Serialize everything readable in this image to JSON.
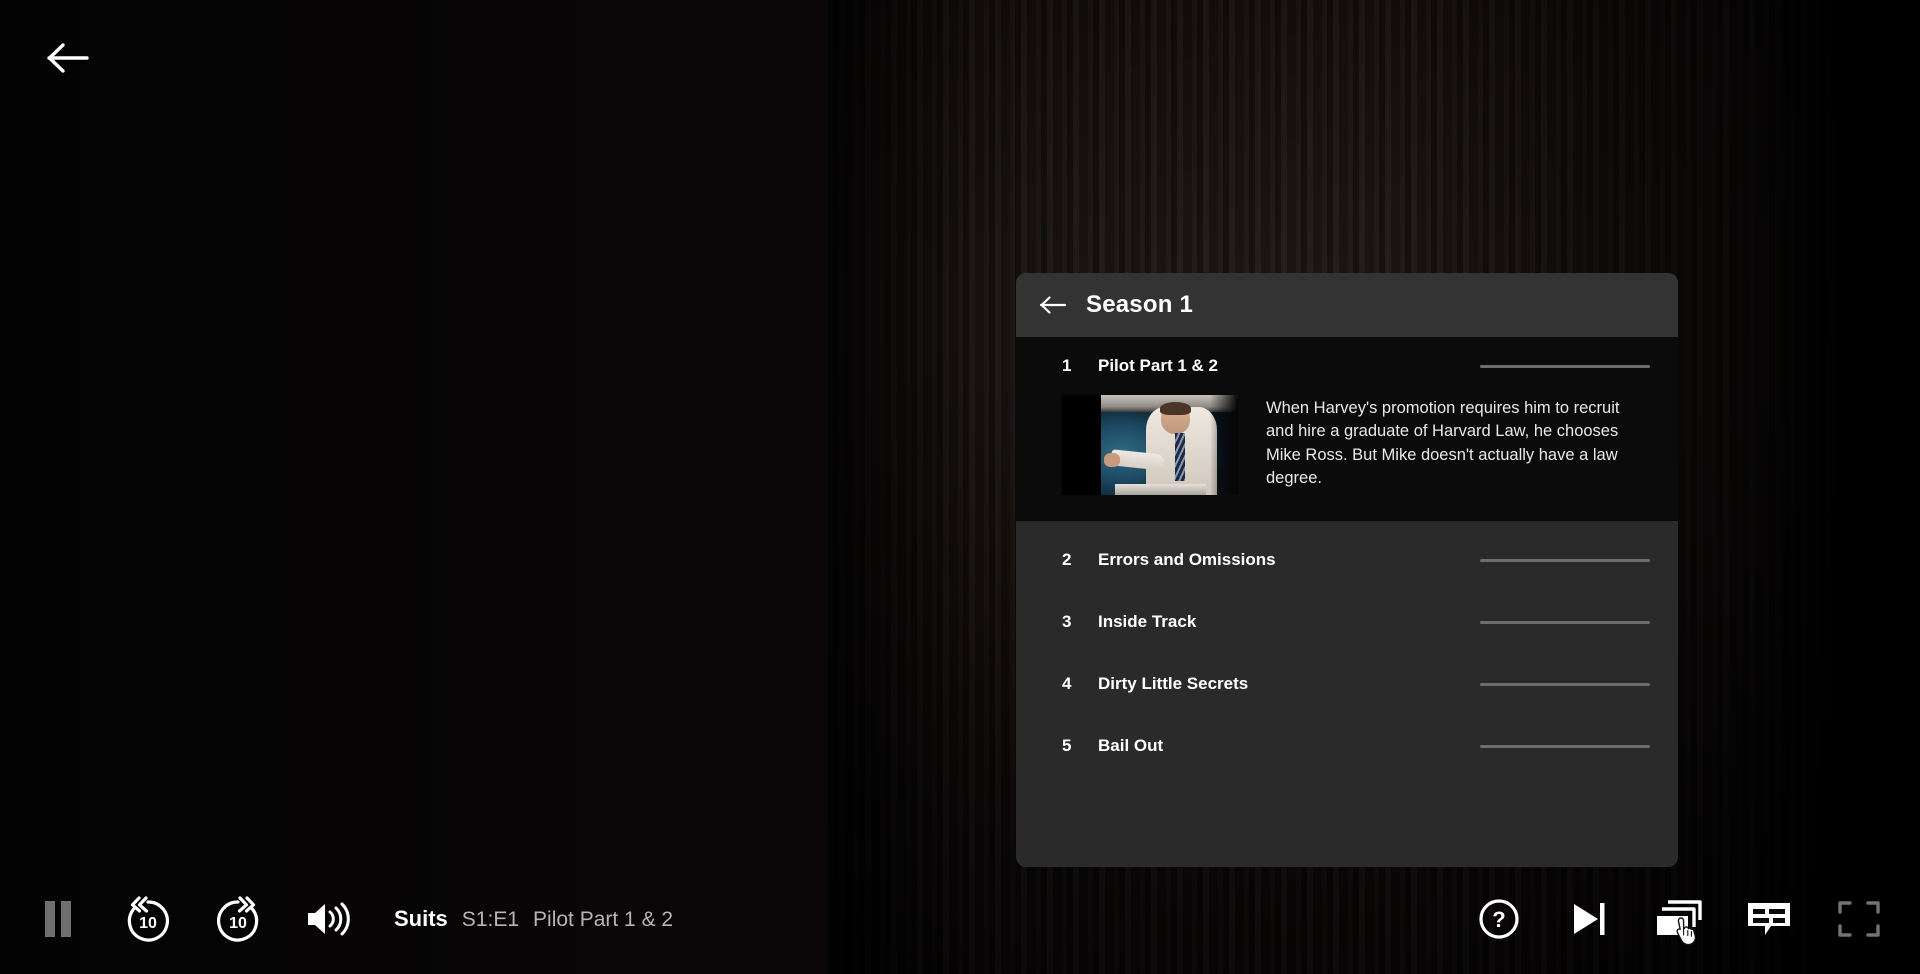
{
  "player": {
    "back_icon": "arrow-left-icon",
    "now_playing": {
      "show": "Suits",
      "episode_code": "S1:E1",
      "episode_title": "Pilot Part 1 & 2"
    },
    "left_controls": [
      {
        "name": "pause-button",
        "icon": "pause-icon",
        "label": "Pause"
      },
      {
        "name": "rewind-10-button",
        "icon": "rewind-10-icon",
        "label": "10"
      },
      {
        "name": "forward-10-button",
        "icon": "forward-10-icon",
        "label": "10"
      },
      {
        "name": "volume-button",
        "icon": "volume-high-icon",
        "label": "Volume"
      }
    ],
    "right_controls": [
      {
        "name": "help-button",
        "icon": "question-circle-icon",
        "label": "Help"
      },
      {
        "name": "next-episode-button",
        "icon": "next-track-icon",
        "label": "Next Episode"
      },
      {
        "name": "episodes-button",
        "icon": "stacked-windows-icon",
        "label": "Episodes"
      },
      {
        "name": "subtitles-button",
        "icon": "subtitles-icon",
        "label": "Subtitles"
      },
      {
        "name": "fullscreen-button",
        "icon": "fullscreen-icon",
        "label": "Fullscreen"
      }
    ]
  },
  "episode_panel": {
    "back_icon": "arrow-left-icon",
    "title": "Season 1",
    "episodes": [
      {
        "number": "1",
        "title": "Pilot Part 1 & 2",
        "selected": true,
        "description": "When Harvey's promotion requires him to recruit and hire a graduate of Harvard Law, he chooses Mike Ross. But Mike doesn't actually have a law degree."
      },
      {
        "number": "2",
        "title": "Errors and Omissions",
        "selected": false,
        "description": ""
      },
      {
        "number": "3",
        "title": "Inside Track",
        "selected": false,
        "description": ""
      },
      {
        "number": "4",
        "title": "Dirty Little Secrets",
        "selected": false,
        "description": ""
      },
      {
        "number": "5",
        "title": "Bail Out",
        "selected": false,
        "description": ""
      }
    ]
  },
  "colors": {
    "panel_background": "#2a2a2a",
    "panel_header_background": "#333333",
    "selected_episode_background": "#0b0b0b",
    "text_primary": "#ffffff",
    "text_secondary": "#b6b6b6",
    "progress_track": "#6d6d6d"
  }
}
